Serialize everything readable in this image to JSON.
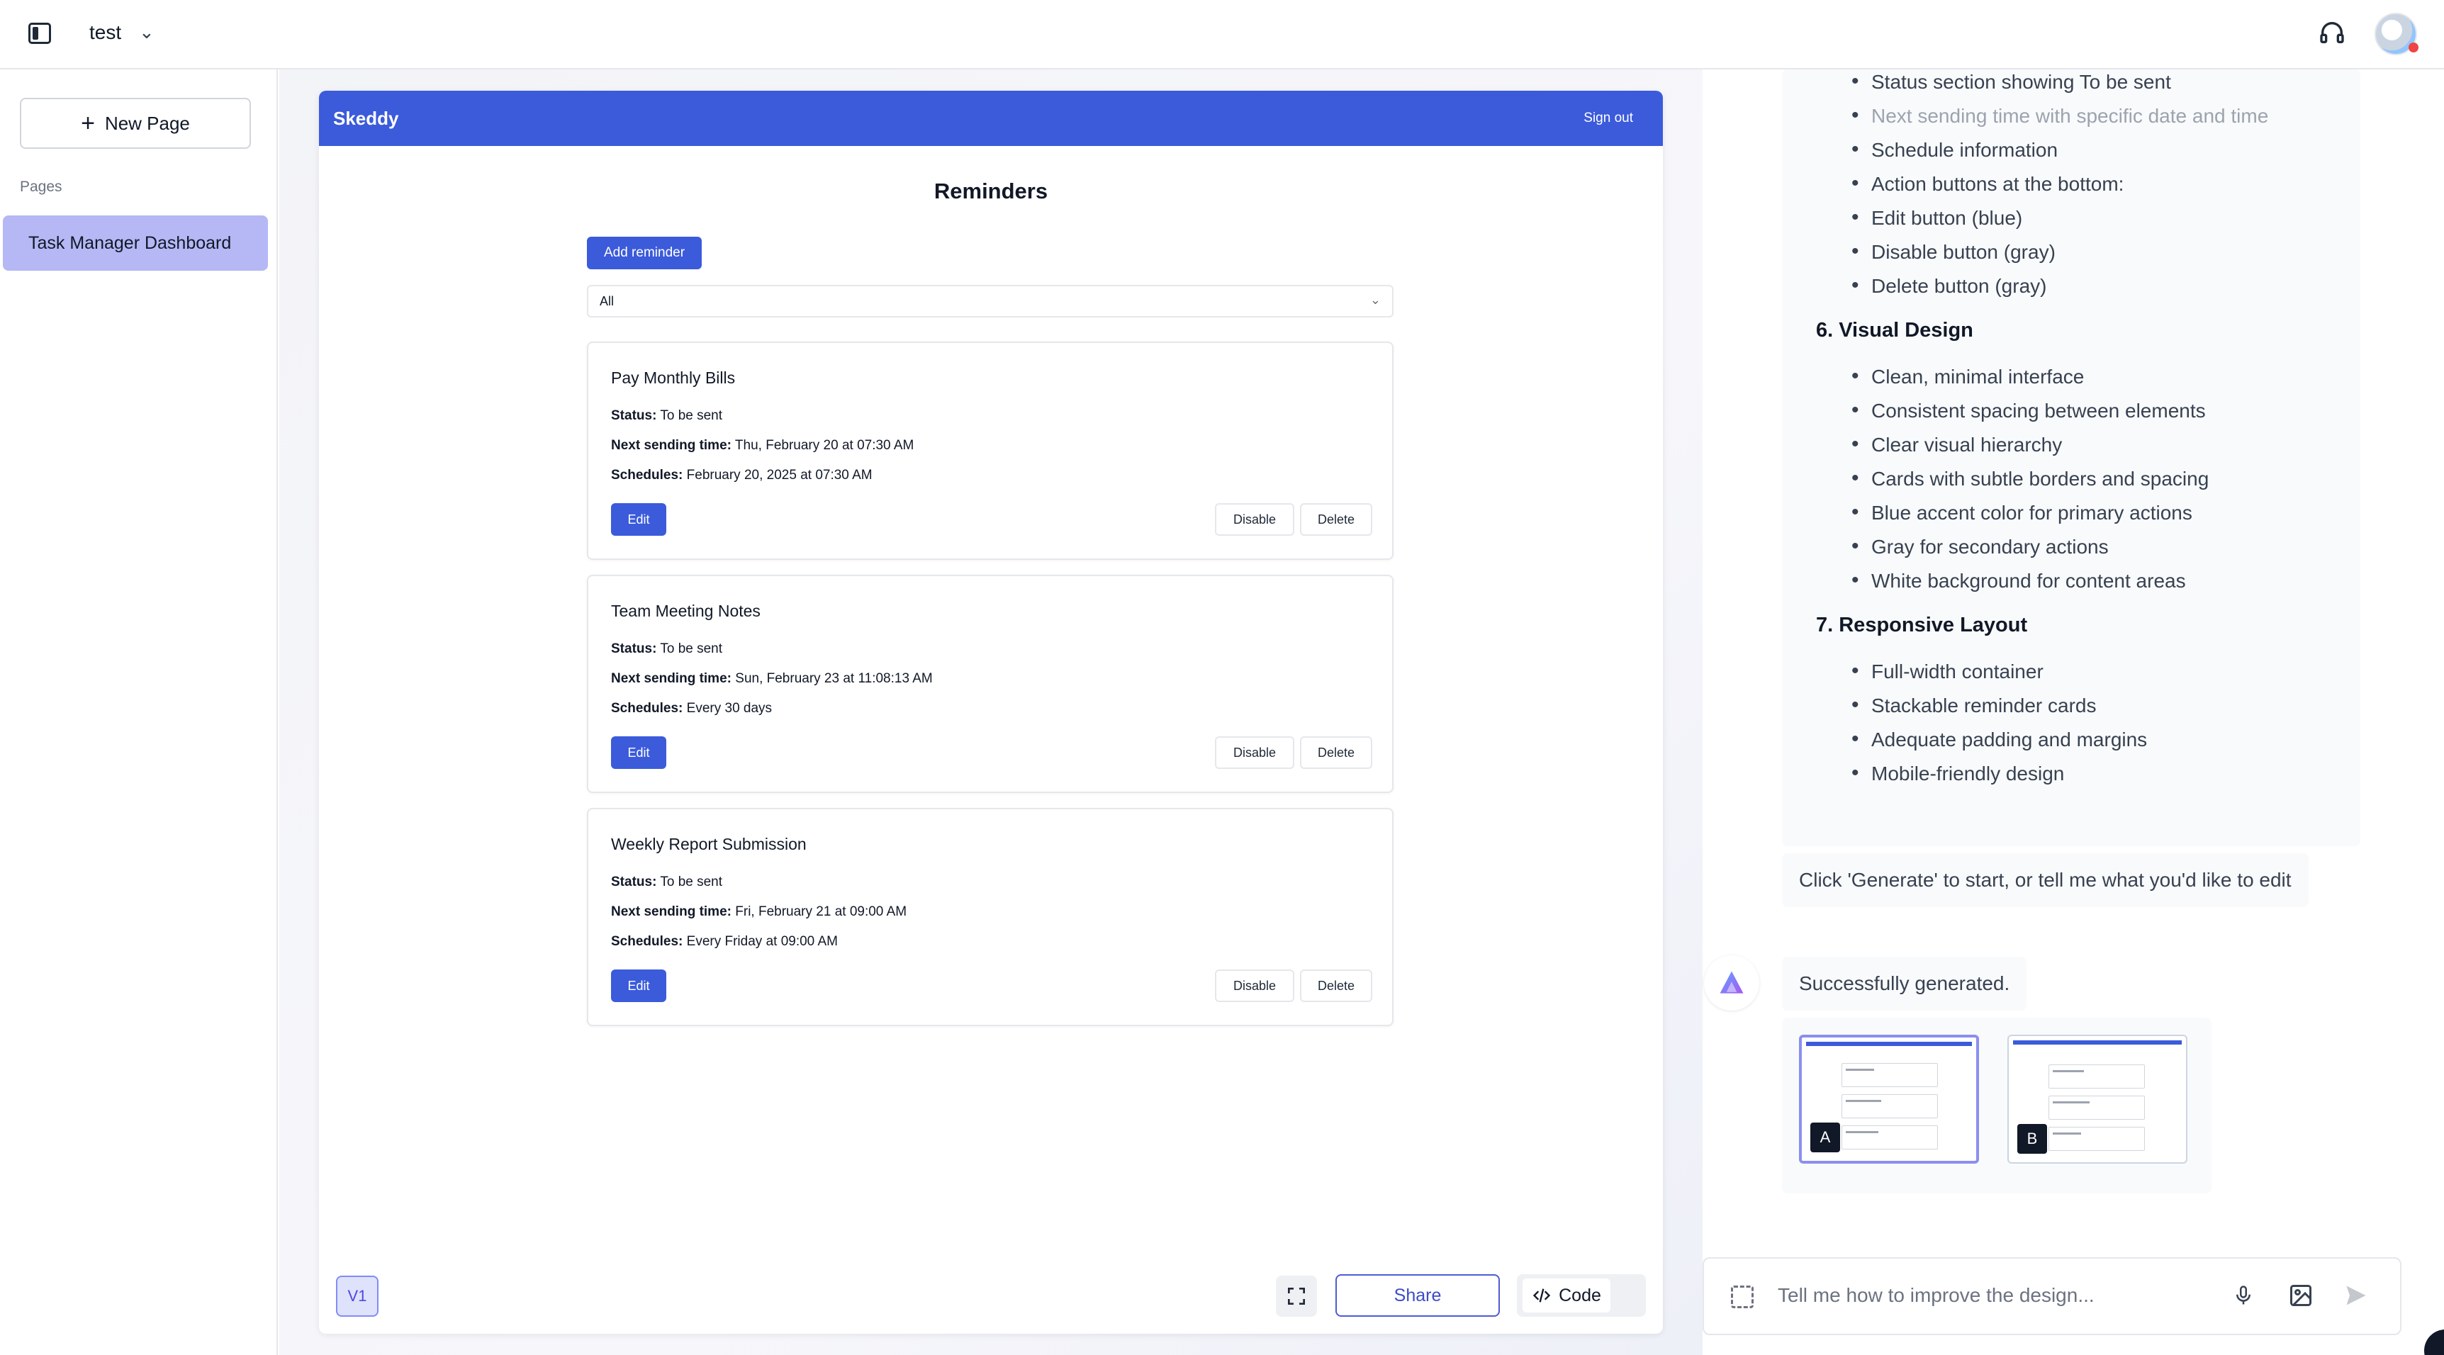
{
  "topbar": {
    "project_name": "test",
    "chevron": "⌄"
  },
  "sidebar": {
    "new_page_label": "New Page",
    "pages_label": "Pages",
    "pages": [
      {
        "label": "Task Manager Dashboard",
        "selected": true
      }
    ]
  },
  "preview": {
    "brand": "Skeddy",
    "sign_out": "Sign out",
    "title": "Reminders",
    "add_reminder": "Add reminder",
    "filter_value": "All",
    "cards": [
      {
        "title": "Pay Monthly Bills",
        "status_label": "Status:",
        "status": "To be sent",
        "next_label": "Next sending time:",
        "next": "Thu, February 20 at 07:30 AM",
        "schedules_label": "Schedules:",
        "schedules": "February 20, 2025 at 07:30 AM",
        "edit": "Edit",
        "disable": "Disable",
        "delete": "Delete"
      },
      {
        "title": "Team Meeting Notes",
        "status_label": "Status:",
        "status": "To be sent",
        "next_label": "Next sending time:",
        "next": "Sun, February 23 at 11:08:13 AM",
        "schedules_label": "Schedules:",
        "schedules": "Every 30 days",
        "edit": "Edit",
        "disable": "Disable",
        "delete": "Delete"
      },
      {
        "title": "Weekly Report Submission",
        "status_label": "Status:",
        "status": "To be sent",
        "next_label": "Next sending time:",
        "next": "Fri, February 21 at 09:00 AM",
        "schedules_label": "Schedules:",
        "schedules": "Every Friday at 09:00 AM",
        "edit": "Edit",
        "disable": "Disable",
        "delete": "Delete"
      }
    ]
  },
  "toolbar": {
    "version": "V1",
    "share": "Share",
    "code": "Code"
  },
  "chat": {
    "faded_item": "Status section showing To be sent",
    "list_a": [
      "Next sending time with specific date and time",
      "Schedule information",
      "Action buttons at the bottom:",
      "Edit button (blue)",
      "Disable button (gray)",
      "Delete button (gray)"
    ],
    "section_6": "6. Visual Design",
    "list_6": [
      "Clean, minimal interface",
      "Consistent spacing between elements",
      "Clear visual hierarchy",
      "Cards with subtle borders and spacing",
      "Blue accent color for primary actions",
      "Gray for secondary actions",
      "White background for content areas"
    ],
    "section_7": "7. Responsive Layout",
    "list_7": [
      "Full-width container",
      "Stackable reminder cards",
      "Adequate padding and margins",
      "Mobile-friendly design"
    ],
    "hint": "Click 'Generate' to start, or tell me what you'd like to edit",
    "success": "Successfully generated.",
    "thumbnails": [
      {
        "label": "A",
        "selected": true
      },
      {
        "label": "B",
        "selected": false
      }
    ],
    "input_placeholder": "Tell me how to improve the design..."
  },
  "colors": {
    "primary": "#3b5bdb",
    "selected_page": "#b5b8f5",
    "accent_purple": "#8b8ff0"
  },
  "icons": [
    "sidebar-toggle-icon",
    "chevron-down-icon",
    "headset-icon",
    "plus-icon",
    "fullscreen-icon",
    "code-icon",
    "select-area-icon",
    "mic-icon",
    "image-icon",
    "send-icon",
    "logo-icon"
  ]
}
